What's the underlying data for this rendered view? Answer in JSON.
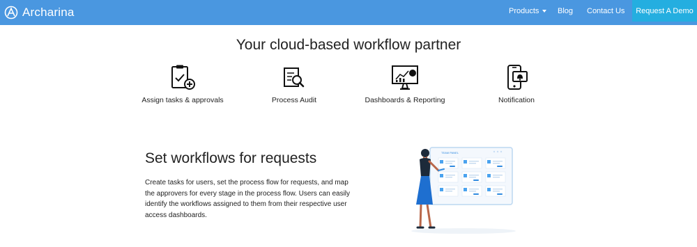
{
  "nav": {
    "brand": "Archarina",
    "links": [
      {
        "label": "Products"
      },
      {
        "label": "Blog"
      },
      {
        "label": "Contact Us"
      }
    ],
    "cta_label": "Request A Demo"
  },
  "hero": {
    "headline": "Your cloud-based workflow partner"
  },
  "features": [
    {
      "label": "Assign tasks & approvals",
      "icon": "clipboard-check-icon"
    },
    {
      "label": "Process Audit",
      "icon": "document-search-icon"
    },
    {
      "label": "Dashboards & Reporting",
      "icon": "monitor-chart-icon"
    },
    {
      "label": "Notification",
      "icon": "phone-bell-icon"
    }
  ],
  "section": {
    "title": "Set workflows for requests",
    "body": "Create tasks for users, set the process flow for requests, and map the approvers for every stage in the process flow. Users can easily identify the workflows assigned to them from their respective user access dashboards.",
    "illustration_panel_title": "TEAM PANEL"
  },
  "colors": {
    "nav_bg": "#4a97e0",
    "cta_bg": "#24aee0",
    "accent_blue": "#2f8ae0"
  }
}
